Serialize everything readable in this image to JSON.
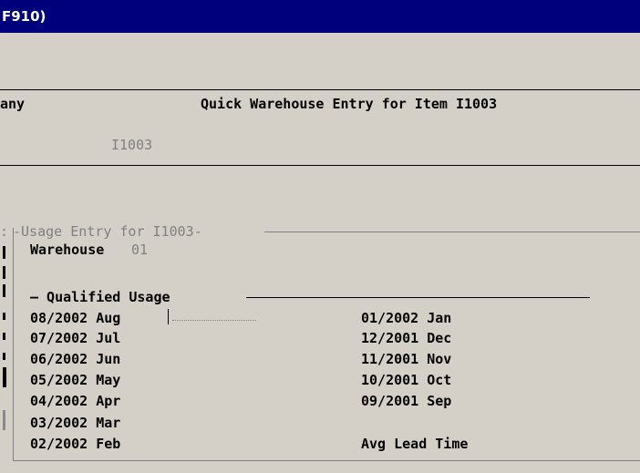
{
  "window": {
    "title": "F910)"
  },
  "header": {
    "left_label": "any",
    "title": "Quick Warehouse Entry for Item I1003",
    "item_value": "I1003"
  },
  "panel": {
    "title": "Usage Entry for I1003",
    "warehouse_label": "Warehouse",
    "warehouse_value": "01",
    "section_title": "— Qualified Usage",
    "left_rows": [
      "08/2002 Aug",
      "07/2002 Jul",
      "06/2002 Jun",
      "05/2002 May",
      "04/2002 Apr",
      "03/2002 Mar",
      "02/2002 Feb"
    ],
    "right_rows": [
      "01/2002 Jan",
      "12/2001 Dec",
      "11/2001 Nov",
      "10/2001 Oct",
      "09/2001 Sep"
    ],
    "avg_lead_time_label": "Avg Lead Time"
  }
}
